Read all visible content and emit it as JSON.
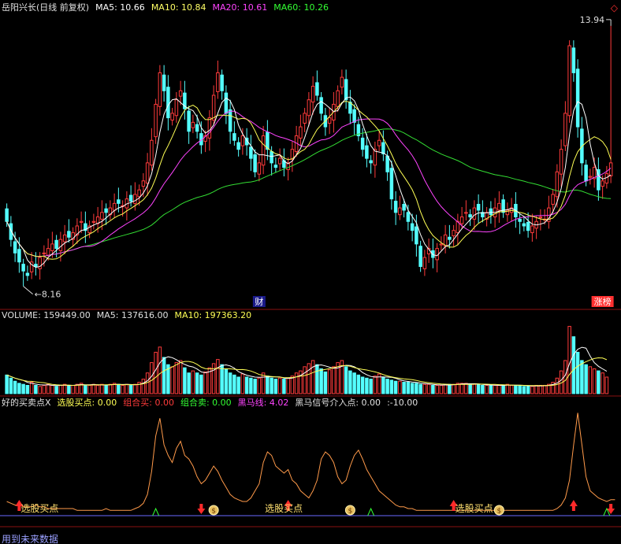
{
  "window": {
    "close_glyph": "◇",
    "footer": "用到未来数据"
  },
  "header": {
    "items": [
      {
        "text": "岳阳兴长(日线 前复权)",
        "color": "#e0e0e0"
      },
      {
        "text": "MA5: 10.66",
        "color": "#ffffff"
      },
      {
        "text": "MA10: 10.84",
        "color": "#ffff66"
      },
      {
        "text": "MA20: 10.61",
        "color": "#ff44ff"
      },
      {
        "text": "MA60: 10.26",
        "color": "#33ff33"
      }
    ]
  },
  "colors": {
    "up": "#ff3b3b",
    "down": "#54ffff",
    "ma5": "#ffffff",
    "ma10": "#ffff55",
    "ma20": "#ff44ff",
    "ma60": "#33dd33",
    "grid": "#8a1010",
    "ind": "#ff9a4a"
  },
  "badges": [
    {
      "text": "财",
      "index": 61
    },
    {
      "text": "涨榜",
      "index": 144
    }
  ],
  "volume_header": {
    "items": [
      {
        "text": "VOLUME: 159449.00",
        "color": "#e0e0e0"
      },
      {
        "text": "MA5: 137616.00",
        "color": "#e0e0e0"
      },
      {
        "text": "MA10: 197363.20",
        "color": "#ffff55"
      }
    ]
  },
  "indicator_header": {
    "items": [
      {
        "text": "好的买卖点X",
        "color": "#e0e0e0"
      },
      {
        "text": "选股买点: 0.00",
        "color": "#ffff55"
      },
      {
        "text": "组合买: 0.00",
        "color": "#ff3b3b"
      },
      {
        "text": "组合卖: 0.00",
        "color": "#33ff33"
      },
      {
        "text": "黑马线: 4.02",
        "color": "#ff44ff"
      },
      {
        "text": "黑马信号介入点: 0.00",
        "color": "#e0e0e0"
      },
      {
        "text": ":-10.00",
        "color": "#e0e0e0"
      }
    ]
  },
  "indicator_labels": [
    {
      "text": "选股买点",
      "index": 3
    },
    {
      "text": "选股买点",
      "index": 62
    },
    {
      "text": "选股买点",
      "index": 108
    }
  ],
  "chart_data": {
    "type": "candlestick",
    "title": "岳阳兴长(日线 前复权)",
    "price_ylim": [
      7.7,
      14.2
    ],
    "annotations": [
      {
        "text": "13.94",
        "value": 13.94,
        "index": 146,
        "kind": "high"
      },
      {
        "text": "8.16",
        "value": 8.16,
        "index": 4,
        "kind": "low"
      }
    ],
    "closes": [
      9.6,
      9.2,
      8.9,
      8.7,
      8.5,
      8.4,
      8.7,
      8.6,
      8.8,
      8.9,
      9.0,
      9.1,
      9.0,
      9.2,
      9.3,
      9.25,
      9.35,
      9.5,
      9.6,
      9.4,
      9.5,
      9.6,
      9.7,
      9.8,
      9.8,
      9.9,
      10.0,
      10.0,
      9.95,
      10.1,
      10.05,
      10.2,
      10.3,
      10.5,
      10.9,
      11.4,
      12.2,
      12.9,
      12.5,
      11.9,
      12.0,
      12.3,
      12.5,
      12.1,
      11.6,
      11.8,
      11.6,
      11.3,
      11.5,
      11.9,
      12.4,
      12.9,
      12.5,
      12.0,
      11.6,
      11.4,
      11.2,
      11.5,
      11.3,
      11.0,
      10.7,
      10.9,
      11.5,
      11.2,
      10.9,
      10.8,
      11.0,
      10.8,
      10.9,
      11.2,
      11.5,
      11.7,
      12.0,
      12.3,
      12.6,
      12.4,
      12.0,
      11.7,
      11.9,
      12.2,
      12.5,
      12.8,
      12.3,
      12.0,
      11.8,
      11.5,
      11.2,
      11.0,
      10.9,
      11.2,
      11.4,
      11.1,
      10.7,
      10.1,
      9.8,
      9.9,
      9.85,
      9.6,
      9.4,
      9.1,
      8.6,
      8.8,
      9.0,
      8.8,
      9.0,
      9.1,
      9.3,
      9.2,
      9.4,
      9.6,
      9.7,
      9.8,
      9.7,
      9.9,
      9.85,
      9.7,
      9.8,
      9.75,
      9.9,
      10.0,
      9.8,
      9.85,
      9.9,
      9.7,
      9.6,
      9.5,
      9.4,
      9.5,
      9.6,
      9.7,
      9.65,
      9.9,
      10.2,
      10.7,
      11.2,
      12.0,
      13.5,
      12.9,
      11.7,
      10.9,
      10.5,
      10.6,
      10.8,
      10.3,
      10.5,
      10.66,
      10.9
    ],
    "volume": [
      18,
      15,
      12,
      10,
      9,
      8,
      11,
      8,
      7,
      8,
      9,
      8,
      7,
      8,
      9,
      8,
      8,
      9,
      10,
      8,
      8,
      9,
      8,
      9,
      8,
      9,
      10,
      9,
      8,
      9,
      8,
      9,
      11,
      14,
      20,
      30,
      40,
      45,
      35,
      28,
      26,
      30,
      32,
      25,
      20,
      22,
      20,
      18,
      21,
      25,
      29,
      33,
      28,
      24,
      20,
      18,
      16,
      19,
      16,
      15,
      14,
      15,
      20,
      17,
      15,
      14,
      15,
      14,
      15,
      17,
      20,
      22,
      26,
      29,
      32,
      28,
      24,
      21,
      23,
      26,
      30,
      32,
      26,
      22,
      20,
      18,
      16,
      15,
      14,
      17,
      19,
      16,
      14,
      13,
      12,
      12,
      11,
      11,
      10,
      10,
      9,
      9,
      9,
      8,
      8,
      8,
      9,
      9,
      9,
      10,
      10,
      10,
      9,
      9,
      9,
      8,
      8,
      8,
      8,
      8,
      8,
      9,
      8,
      8,
      8,
      7,
      7,
      7,
      8,
      8,
      8,
      9,
      11,
      15,
      22,
      32,
      65,
      55,
      40,
      32,
      28,
      26,
      24,
      22,
      20,
      16
    ],
    "vol_ylim": [
      0,
      70
    ],
    "indicator": [
      8,
      7,
      6,
      6,
      5,
      5,
      5,
      6,
      5,
      5,
      4,
      4,
      4,
      4,
      4,
      4,
      4,
      3,
      3,
      3,
      3,
      3,
      3,
      3,
      4,
      3,
      3,
      3,
      3,
      3,
      3,
      4,
      5,
      7,
      12,
      25,
      45,
      55,
      40,
      34,
      30,
      38,
      42,
      34,
      32,
      28,
      22,
      18,
      20,
      24,
      28,
      25,
      20,
      16,
      12,
      10,
      9,
      8,
      8,
      10,
      14,
      18,
      30,
      36,
      34,
      28,
      26,
      24,
      26,
      20,
      18,
      14,
      12,
      10,
      14,
      20,
      32,
      36,
      34,
      30,
      22,
      18,
      20,
      28,
      34,
      37,
      32,
      26,
      22,
      18,
      14,
      12,
      10,
      8,
      6,
      5,
      5,
      4,
      4,
      3,
      3,
      3,
      3,
      3,
      3,
      3,
      3,
      3,
      3,
      3,
      3,
      3,
      3,
      3,
      3,
      3,
      3,
      3,
      3,
      3,
      3,
      3,
      3,
      3,
      3,
      3,
      3,
      3,
      3,
      3,
      3,
      3,
      3,
      4,
      6,
      10,
      20,
      40,
      58,
      40,
      22,
      14,
      12,
      10,
      9,
      8,
      9,
      9
    ],
    "ind_ylim": [
      0,
      60
    ],
    "marks": {
      "up_arrows": [
        3,
        68,
        108,
        137,
        154
      ],
      "down_arrows": [
        47,
        146
      ],
      "coins": [
        50,
        83,
        119
      ],
      "green_triangles": [
        36,
        88,
        145
      ]
    }
  }
}
